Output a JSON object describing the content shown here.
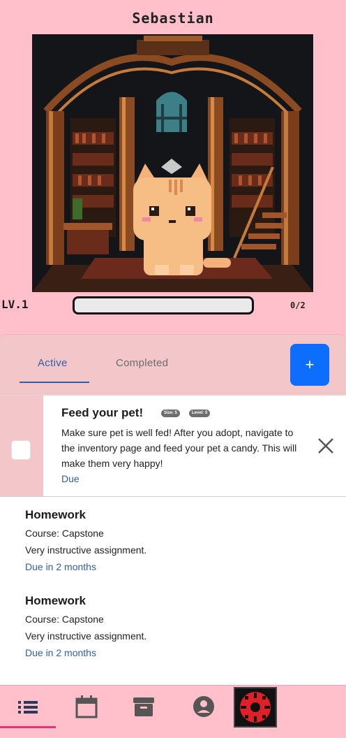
{
  "pet": {
    "name": "Sebastian",
    "level_label": "LV.1",
    "xp_text": "0/2",
    "xp_fraction": 0
  },
  "tabs": {
    "active": "Active",
    "completed": "Completed",
    "add_label": "+"
  },
  "featured_task": {
    "title": "Feed your pet!",
    "size_badge": "Size: 5",
    "level_badge": "Level: 5",
    "description": "Make sure pet is well fed! After you adopt, navigate to the inventory page and feed your pet a candy. This will make them very happy!",
    "due": "Due"
  },
  "tasks": [
    {
      "title": "Homework",
      "course": "Course: Capstone",
      "description": "Very instructive assignment.",
      "due": "Due in 2 months"
    },
    {
      "title": "Homework",
      "course": "Course: Capstone",
      "description": "Very instructive assignment.",
      "due": "Due in 2 months"
    }
  ],
  "nav": {
    "items": [
      "list-icon",
      "calendar-icon",
      "archive-icon",
      "account-icon",
      "pet-avatar"
    ],
    "accent": "#e8336e"
  },
  "colors": {
    "background": "#ffc0cb",
    "primary": "#0d6efd",
    "link": "#2f5ea8"
  }
}
